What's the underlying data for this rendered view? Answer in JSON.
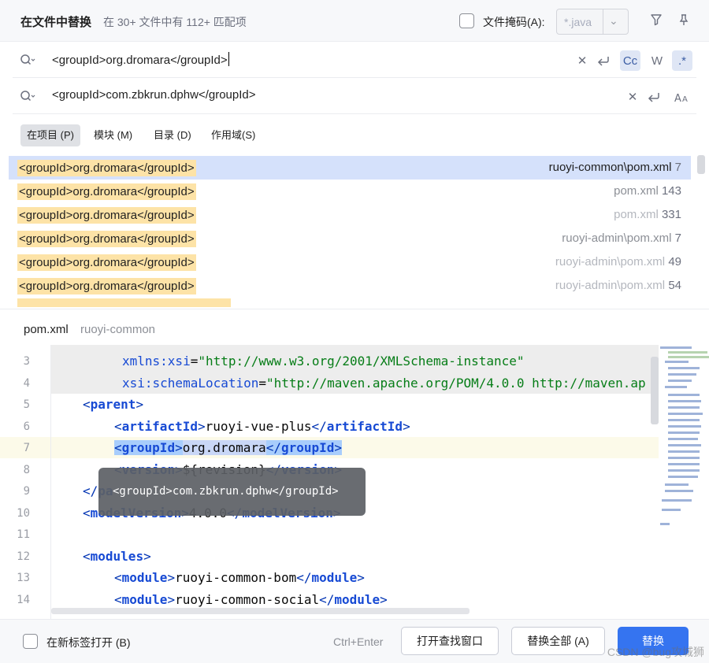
{
  "title": "在文件中替换",
  "summary": "在 30+ 文件中有 112+ 匹配项",
  "file_mask": {
    "label": "文件掩码(A):",
    "value": "*.java"
  },
  "search": {
    "value": "<groupId>org.dromara</groupId>"
  },
  "replace": {
    "value": "<groupId>com.zbkrun.dphw</groupId>"
  },
  "options": {
    "match_case": "Cc",
    "words": "W",
    "regex": ".*"
  },
  "scope_tabs": [
    {
      "label": "在项目 (P)"
    },
    {
      "label": "模块 (M)"
    },
    {
      "label": "目录 (D)"
    },
    {
      "label": "作用域(S)"
    }
  ],
  "results": [
    {
      "match": "<groupId>org.dromara</groupId>",
      "path": "ruoyi-common\\pom.xml",
      "line": "7"
    },
    {
      "match": "<groupId>org.dromara</groupId>",
      "path": "pom.xml",
      "line": "143"
    },
    {
      "match": "<groupId>org.dromara</groupId>",
      "path": "pom.xml",
      "line": "331"
    },
    {
      "match": "<groupId>org.dromara</groupId>",
      "path": "ruoyi-admin\\pom.xml",
      "line": "7"
    },
    {
      "match": "<groupId>org.dromara</groupId>",
      "path": "ruoyi-admin\\pom.xml",
      "line": "49"
    },
    {
      "match": "<groupId>org.dromara</groupId>",
      "path": "ruoyi-admin\\pom.xml",
      "line": "54"
    }
  ],
  "preview": {
    "file": "pom.xml",
    "module": "ruoyi-common"
  },
  "editor": {
    "line_numbers": [
      "3",
      "4",
      "5",
      "6",
      "7",
      "8",
      "9",
      "10",
      "11",
      "12",
      "13",
      "14"
    ],
    "lines": {
      "l3_attr": "xmlns:xsi",
      "l3_eq": "=",
      "l3_str": "\"http://www.w3.org/2001/XMLSchema-instance\"",
      "l4_attr": "xsi:schemaLocation",
      "l4_eq": "=",
      "l4_str": "\"http://maven.apache.org/POM/4.0.0 http://maven.ap",
      "l5_tag": "parent",
      "l6_tag": "artifactId",
      "l6_val": "ruoyi-vue-plus",
      "l7_tag": "groupId",
      "l7_val": "org.dromara",
      "l8_tag": "version",
      "l8_val": "${revision}",
      "l9_tag": "pa",
      "l10_tag": "modelVersion",
      "l10_val": "4.0.0",
      "l12_tag": "modules",
      "l13_tag": "module",
      "l13_val": "ruoyi-common-bom",
      "l14_tag": "module",
      "l14_val": "ruoyi-common-social"
    },
    "tooltip": "<groupId>com.zbkrun.dphw</groupId>"
  },
  "footer": {
    "new_tab_label": "在新标签打开 (B)",
    "shortcut": "Ctrl+Enter",
    "open_find_window": "打开查找窗口",
    "replace_all": "替换全部 (A)",
    "replace": "替换"
  },
  "watermark": "CSDN @bug攻城狮",
  "colors": {
    "accent": "#3574f0",
    "match_highlight": "#fde3a7",
    "selected_row": "#d5e1fb"
  }
}
